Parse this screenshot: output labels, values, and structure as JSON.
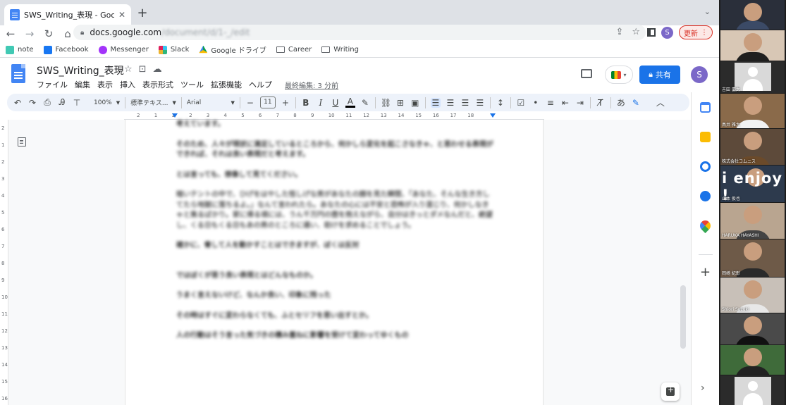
{
  "browser": {
    "tab_title": "SWS_Writing_表現 - Google ドキュメント",
    "tab_close": "✕",
    "new_tab": "+",
    "url_host": "docs.google.com",
    "url_path": "/document/d/1-_/edit",
    "update_label": "更新",
    "profile_initial": "S"
  },
  "bookmarks": [
    {
      "label": "note",
      "color": "#41c9b4"
    },
    {
      "label": "Facebook",
      "color": "#1877f2"
    },
    {
      "label": "Messenger",
      "color": "#a334fa"
    },
    {
      "label": "Slack",
      "color": "#e01e5a"
    },
    {
      "label": "Google ドライブ",
      "color": "#fbbc04"
    },
    {
      "label": "Career",
      "color": "folder"
    },
    {
      "label": "Writing",
      "color": "folder"
    }
  ],
  "docs": {
    "title": "SWS_Writing_表現",
    "menu": [
      "ファイル",
      "編集",
      "表示",
      "挿入",
      "表示形式",
      "ツール",
      "拡張機能",
      "ヘルプ"
    ],
    "last_edit": "最終編集: 3 分前",
    "share_label": "共有",
    "avatar_initial": "S"
  },
  "format_toolbar": {
    "zoom": "100%",
    "style": "標準テキス...",
    "font": "Arial",
    "font_size": "11",
    "input_mode": "あ"
  },
  "ruler": {
    "numbers": [
      "2",
      "1",
      "1",
      "2",
      "3",
      "4",
      "5",
      "6",
      "7",
      "8",
      "9",
      "10",
      "11",
      "12",
      "13",
      "14",
      "15",
      "16",
      "17",
      "18"
    ]
  },
  "vruler": {
    "numbers": [
      "2",
      "1",
      "2",
      "3",
      "4",
      "5",
      "6",
      "7",
      "8",
      "9",
      "10",
      "11",
      "12",
      "13",
      "14",
      "15",
      "16",
      "17",
      "18"
    ]
  },
  "document": {
    "paragraphs": [
      "考えています。",
      "そのため、人々が現状に満足しているところから、何かしら変化を起こさなきゃ、と思わせる表現ができれば、それは良い表現だと考えます。",
      "とは言っても、想像して見てください。",
      "暗いテントの中で、ひげをはやした怪しげな男があなたの顔を見た瞬間、「あなた、そんな生き方してたら地獄に落ちるよ。」なんて言われたら。あなたの心には不安と恐怖が入り混じり、何かしなきゃと焦るばかり。家に帰る頃には、うん千万円の壺を抱えながら、自分はきっとダメなんだと、絶望し、くる日もくる日もあの男のところに通い、助けを求めることでしょう。",
      "確かに、脅して人を動かすことはできますが、ぼくは反対",
      "ではぼくが思う良い表現とはどんなものか。",
      "うまく言えないけど、なんか良い、印象に残った",
      "その時はすぐに変わらなくても、ふとセリフを思い出すとか。",
      "人の行動はそう言った気づきの積み重ねに影響を受けて変わってゆくもの"
    ]
  },
  "video_tiles": [
    {
      "type": "person",
      "name": "",
      "bg": "#2a2f3a",
      "shirt": "#3b4a66"
    },
    {
      "type": "person",
      "name": "",
      "bg": "#d8c7b5",
      "shirt": "#1f1f1f"
    },
    {
      "type": "avatar",
      "name": "吉田 慶太",
      "bg": "#2b2b2b"
    },
    {
      "type": "person",
      "name": "鳥井 雅大",
      "bg": "#8a6a4a",
      "shirt": "#f2f2f2"
    },
    {
      "type": "person",
      "name": "株式会社コムニス",
      "bg": "#5d4a3a",
      "shirt": "#6b4a2a"
    },
    {
      "type": "enjoy",
      "name": "山本 俊也",
      "bg": "#2d3a4d",
      "overlay": "i enjoy !"
    },
    {
      "type": "person",
      "name": "HARUKA HAYASHI",
      "bg": "#b9a590",
      "shirt": "#444"
    },
    {
      "type": "person",
      "name": "岡崎 紀彰",
      "bg": "#6e5a48",
      "shirt": "#2a2a2a"
    },
    {
      "type": "person",
      "name": "Shiori Suzuki",
      "bg": "#c8c0b8",
      "shirt": "#e8e8e8"
    },
    {
      "type": "person",
      "name": "",
      "bg": "#4a4a4a",
      "shirt": "#111"
    },
    {
      "type": "person",
      "name": "",
      "bg": "#3f6b3a",
      "shirt": "#222"
    },
    {
      "type": "avatar",
      "name": "",
      "bg": "#2b2b2b"
    }
  ],
  "colors": {
    "accent": "#1a73e8",
    "docs_blue": "#4285f4",
    "update_red": "#d93025"
  }
}
